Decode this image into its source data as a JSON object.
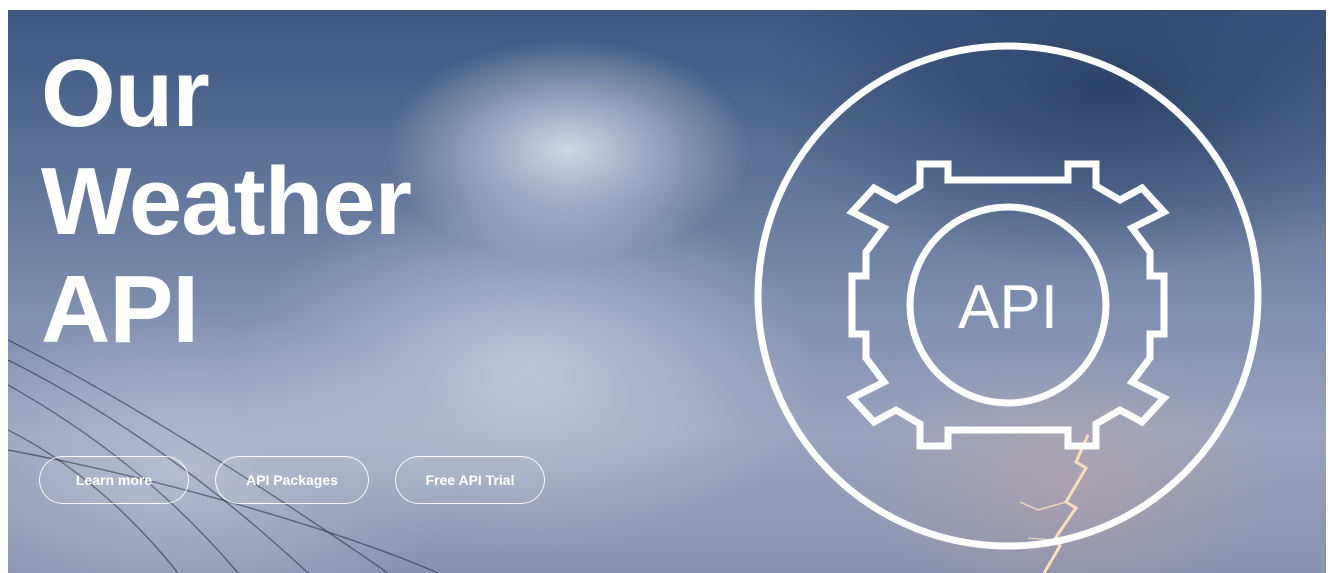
{
  "hero": {
    "title_lines": [
      "Our",
      "Weather",
      "API"
    ],
    "logo_text": "API",
    "logo_icon": "gear-api-icon"
  },
  "buttons": {
    "learn_more": "Learn more",
    "api_packages": "API Packages",
    "free_trial": "Free API Trial"
  },
  "colors": {
    "text": "#ffffff",
    "sky_top": "#3b5680",
    "sky_bottom": "#8a92ae"
  }
}
